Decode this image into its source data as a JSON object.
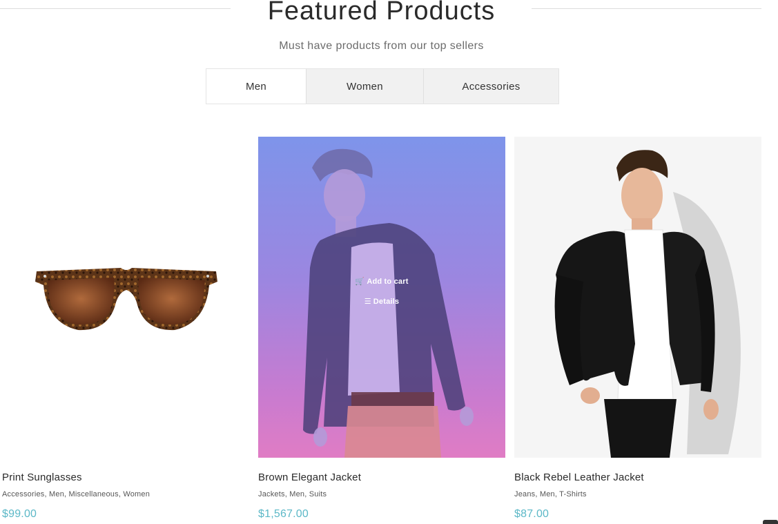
{
  "section": {
    "title": "Featured Products",
    "subtitle": "Must have products from our top sellers"
  },
  "tabs": [
    {
      "label": "Men",
      "active": true
    },
    {
      "label": "Women",
      "active": false
    },
    {
      "label": "Accessories",
      "active": false
    }
  ],
  "products": [
    {
      "name": "Print Sunglasses",
      "categories": "Accessories, Men, Miscellaneous, Women",
      "price": "$99.00",
      "image_icon": "sunglasses-image"
    },
    {
      "name": "Brown Elegant Jacket",
      "categories": "Jackets, Men, Suits",
      "price": "$1,567.00",
      "image_icon": "man-in-blazer-image",
      "hover_actions": {
        "add_to_cart": "Add to cart",
        "details": "Details"
      }
    },
    {
      "name": "Black Rebel Leather Jacket",
      "categories": "Jeans, Men, T-Shirts",
      "price": "$87.00",
      "image_icon": "man-in-leather-jacket-image"
    }
  ],
  "colors": {
    "price": "#5cb8c7",
    "hover_gradient_top": "#7e94ea",
    "hover_gradient_bottom": "#e07cc4",
    "tab_inactive_bg": "#f1f1f1"
  }
}
